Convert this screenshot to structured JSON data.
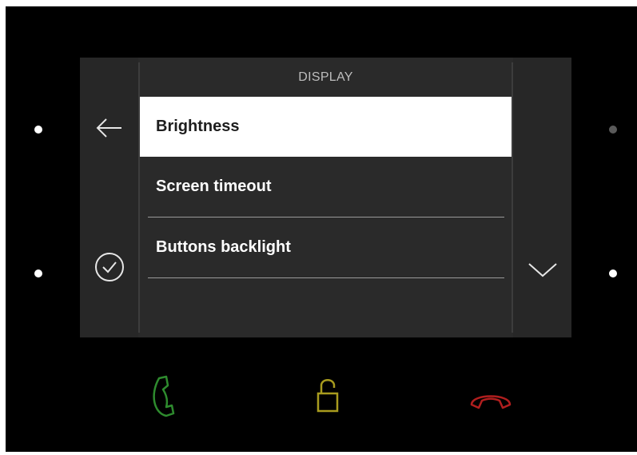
{
  "screen": {
    "title": "DISPLAY",
    "menu_items": [
      {
        "label": "Brightness",
        "selected": true
      },
      {
        "label": "Screen timeout",
        "selected": false
      },
      {
        "label": "Buttons backlight",
        "selected": false
      }
    ],
    "left_buttons": [
      "back-arrow-icon",
      "check-circle-icon"
    ],
    "right_buttons": [
      "chevron-down-icon"
    ]
  },
  "hardware_buttons": [
    "accept-call-icon",
    "unlock-icon",
    "end-call-icon"
  ],
  "colors": {
    "device_background": "#000000",
    "screen_background": "#2a2a2a",
    "selected_item_background": "#ffffff",
    "accept_call": "#2e8b2e",
    "unlock": "#a89b1e",
    "end_call": "#b01e1e"
  }
}
